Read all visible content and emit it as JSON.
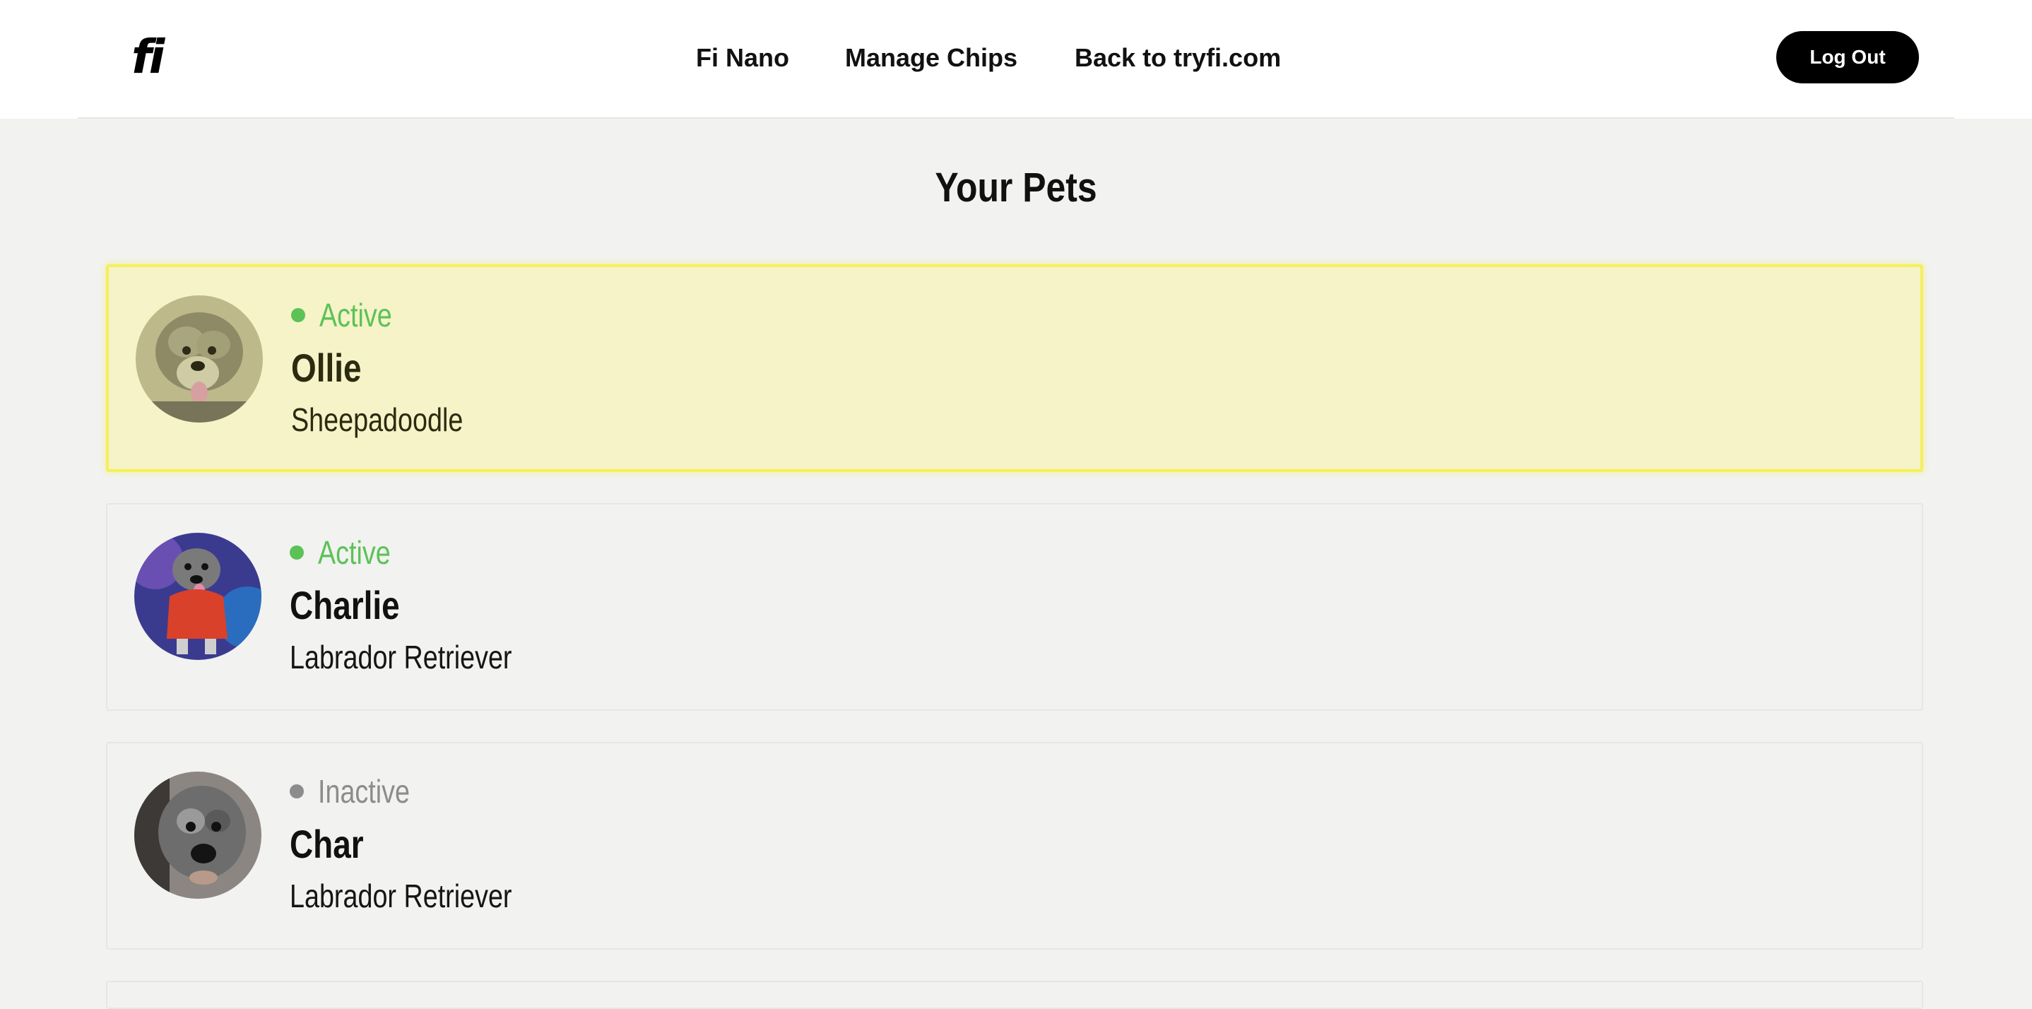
{
  "header": {
    "logo_text": "fi",
    "nav": [
      {
        "label": "Fi Nano"
      },
      {
        "label": "Manage Chips"
      },
      {
        "label": "Back to tryfi.com"
      }
    ],
    "logout_label": "Log Out"
  },
  "page": {
    "title": "Your Pets"
  },
  "pets": [
    {
      "status": "Active",
      "status_color": "#5cc257",
      "name": "Ollie",
      "breed": "Sheepadoodle",
      "selected": true,
      "avatar_icon": "dog-photo"
    },
    {
      "status": "Active",
      "status_color": "#5cc257",
      "name": "Charlie",
      "breed": "Labrador Retriever",
      "selected": false,
      "avatar_icon": "dog-photo"
    },
    {
      "status": "Inactive",
      "status_color": "#8c8c8c",
      "name": "Char",
      "breed": "Labrador Retriever",
      "selected": false,
      "avatar_icon": "dog-photo"
    }
  ],
  "colors": {
    "active": "#5cc257",
    "inactive": "#8c8c8c",
    "selected_bg": "#f5f3c7",
    "selected_border": "#f4f05a",
    "button_bg": "#000000"
  }
}
